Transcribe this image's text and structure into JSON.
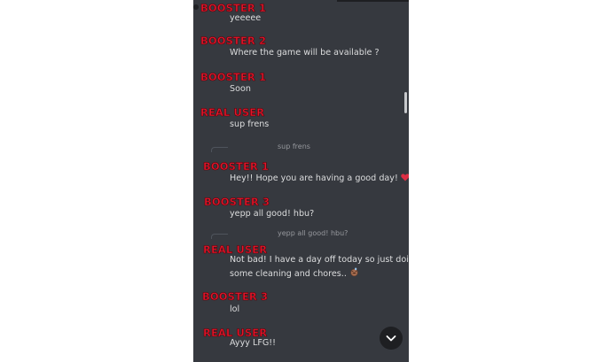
{
  "messages": [
    {
      "author": "BOOSTER 1",
      "text": "yeeeee"
    },
    {
      "author": "BOOSTER 2",
      "text": "Where the game will be available ?"
    },
    {
      "author": "BOOSTER 1",
      "text": "Soon"
    },
    {
      "author": "REAL USER",
      "text": "sup frens"
    },
    {
      "reply_to": "sup frens",
      "author": "BOOSTER 1",
      "text": "Hey!! Hope you are having a good day!",
      "emoji": "heart-icon"
    },
    {
      "author": "BOOSTER 3",
      "text": "yepp all good! hbu?"
    },
    {
      "reply_to": "yepp all good! hbu?",
      "author": "REAL USER",
      "text_line1": "Not bad! I have a day off today so just doing",
      "text_line2": "some cleaning and chores..",
      "emoji": "tired-face-icon"
    },
    {
      "author": "BOOSTER 3",
      "text": "lol"
    },
    {
      "author": "REAL USER",
      "text": "Ayyy LFG!!"
    }
  ],
  "controls": {
    "jump_to_latest_icon": "chevron-down-icon"
  },
  "colors": {
    "panel_bg": "#36393f",
    "author_red": "#e3162b",
    "message_text": "#dcddde",
    "reply_text": "#96989d"
  }
}
